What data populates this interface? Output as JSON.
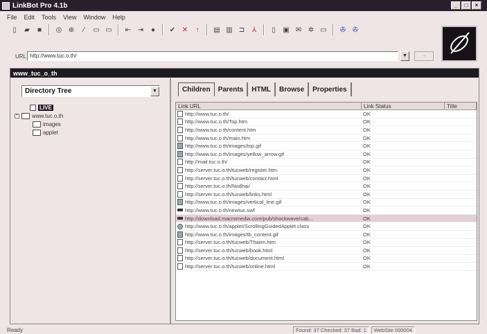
{
  "app": {
    "title": "LinkBot Pro 4.1b"
  },
  "window_buttons": [
    "_",
    "□",
    "×"
  ],
  "menu": [
    "File",
    "Edit",
    "Tools",
    "View",
    "Window",
    "Help"
  ],
  "toolbar": {
    "url_label": "URL",
    "url_value": "http://www.tuc.o.th/",
    "go_label": "→"
  },
  "document": {
    "title": "www_tuc_o_th"
  },
  "left": {
    "combo_value": "Directory Tree",
    "tree": [
      {
        "label": "LIVE",
        "level": 0,
        "root": true
      },
      {
        "label": "www.tuc.o.th",
        "level": 0,
        "expander": "+"
      },
      {
        "label": "images",
        "level": 2
      },
      {
        "label": "applet",
        "level": 2
      }
    ]
  },
  "tabs": [
    "Children",
    "Parents",
    "HTML",
    "Browse",
    "Properties"
  ],
  "grid": {
    "columns": [
      "Link URL",
      "Link Status",
      "Title"
    ],
    "rows": [
      {
        "url": "http://www.tuc.o.th/",
        "status": "OK",
        "icon": "page"
      },
      {
        "url": "http://www.tuc.o.th/Top.htm",
        "status": "OK",
        "icon": "page"
      },
      {
        "url": "http://www.tuc.o.th/content.htm",
        "status": "OK",
        "icon": "page"
      },
      {
        "url": "http://www.tuc.o.th/main.htm",
        "status": "OK",
        "icon": "page"
      },
      {
        "url": "http://www.tuc.o.th/images/top.gif",
        "status": "OK",
        "icon": "img"
      },
      {
        "url": "http://www.tuc.o.th/images/yellow_arrow.gif",
        "status": "OK",
        "icon": "img"
      },
      {
        "url": "http://mail.tuc.o.th/",
        "status": "OK",
        "icon": "page"
      },
      {
        "url": "http://server.tuc.o.th/tucweb/register.htm",
        "status": "OK",
        "icon": "page"
      },
      {
        "url": "http://server.tuc.o.th/tucweb/contact.html",
        "status": "OK",
        "icon": "page"
      },
      {
        "url": "http://server.tuc.o.th/Nodhai/",
        "status": "OK",
        "icon": "page"
      },
      {
        "url": "http://server.tuc.o.th/tucweb/links.html",
        "status": "OK",
        "icon": "page"
      },
      {
        "url": "http://www.tuc.o.th/images/vertical_line.gif",
        "status": "OK",
        "icon": "img"
      },
      {
        "url": "http://www.tuc.o.th/newtuc.swf",
        "status": "OK",
        "icon": "dl"
      },
      {
        "url": "http://download.macromedia.com/pub/shockwave/cab...",
        "status": "OK",
        "icon": "dl",
        "selected": true
      },
      {
        "url": "http://www.tuc.o.th/applet/ScrollingGuidedApplet.class",
        "status": "OK",
        "icon": "app"
      },
      {
        "url": "http://www.tuc.o.th/images/tb_content.gif",
        "status": "OK",
        "icon": "img"
      },
      {
        "url": "http://server.tuc.o.th/tucweb/Thaiim.htm",
        "status": "OK",
        "icon": "page"
      },
      {
        "url": "http://server.tuc.o.th/tucweb/book.html",
        "status": "OK",
        "icon": "page"
      },
      {
        "url": "http://server.tuc.o.th/tucweb/document.html",
        "status": "OK",
        "icon": "page"
      },
      {
        "url": "http://server.tuc.o.th/tucweb/online.html",
        "status": "OK",
        "icon": "page"
      }
    ]
  },
  "status": {
    "ready": "Ready",
    "found": "Found: 37 Checked: 37 Bad: 1",
    "extra": "WebSite 000004"
  }
}
